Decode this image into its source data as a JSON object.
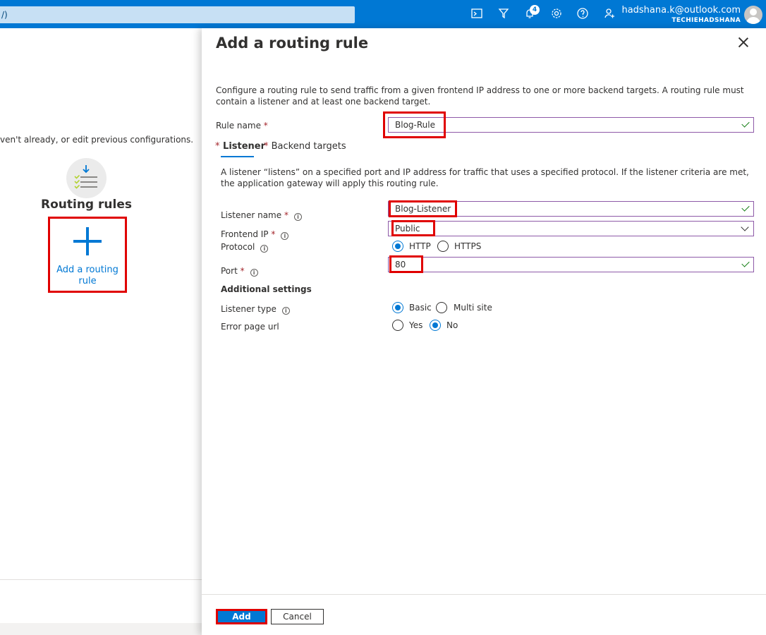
{
  "topbar": {
    "search_text": "/)",
    "notification_count": "4",
    "user_email": "hadshana.k@outlook.com",
    "user_tenant": "TECHIEHADSHANA",
    "icons": [
      "cloud-shell-icon",
      "directory-filter-icon",
      "notifications-icon",
      "settings-icon",
      "help-icon",
      "feedback-icon"
    ]
  },
  "left": {
    "description": "ven't already, or edit previous configurations.",
    "section_title": "Routing rules",
    "add_tile_label": "Add a routing rule"
  },
  "blade": {
    "title": "Add a routing rule",
    "description": "Configure a routing rule to send traffic from a given frontend IP address to one or more backend targets. A routing rule must contain a listener and at least one backend target.",
    "rule_name_label": "Rule name",
    "rule_name_value": "Blog-Rule",
    "required_mark": "*",
    "tabs": [
      {
        "label": "Listener",
        "active": true
      },
      {
        "label": "Backend targets",
        "active": false
      }
    ],
    "listener": {
      "description": "A listener “listens” on a specified port and IP address for traffic that uses a specified protocol. If the listener criteria are met, the application gateway will apply this routing rule.",
      "listener_name_label": "Listener name",
      "listener_name_value": "Blog-Listener",
      "frontend_ip_label": "Frontend IP",
      "frontend_ip_value": "Public",
      "protocol_label": "Protocol",
      "protocol_options": [
        "HTTP",
        "HTTPS"
      ],
      "protocol_selected": "HTTP",
      "port_label": "Port",
      "port_value": "80",
      "additional_settings": "Additional settings",
      "listener_type_label": "Listener type",
      "listener_type_options": [
        "Basic",
        "Multi site"
      ],
      "listener_type_selected": "Basic",
      "error_page_label": "Error page url",
      "error_page_options": [
        "Yes",
        "No"
      ],
      "error_page_selected": "No"
    },
    "add_button": "Add",
    "cancel_button": "Cancel"
  },
  "colors": {
    "brand": "#0078d4",
    "highlight": "#e00000",
    "valid": "#107c10"
  }
}
